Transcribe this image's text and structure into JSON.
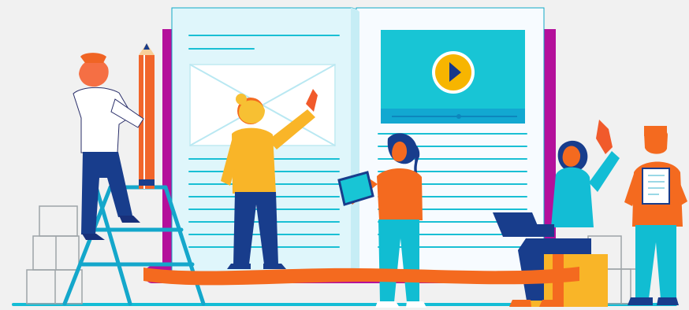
{
  "scene": {
    "background_color": "#f1f1f1",
    "accent_color": "#b4109b",
    "cyan_color": "#1dbfd6",
    "orange_color": "#f46a1f",
    "yellow_color": "#f5b320",
    "navy_color": "#163a8d",
    "play_icon": "play-icon",
    "image_placeholder_icon": "image-placeholder-icon"
  }
}
